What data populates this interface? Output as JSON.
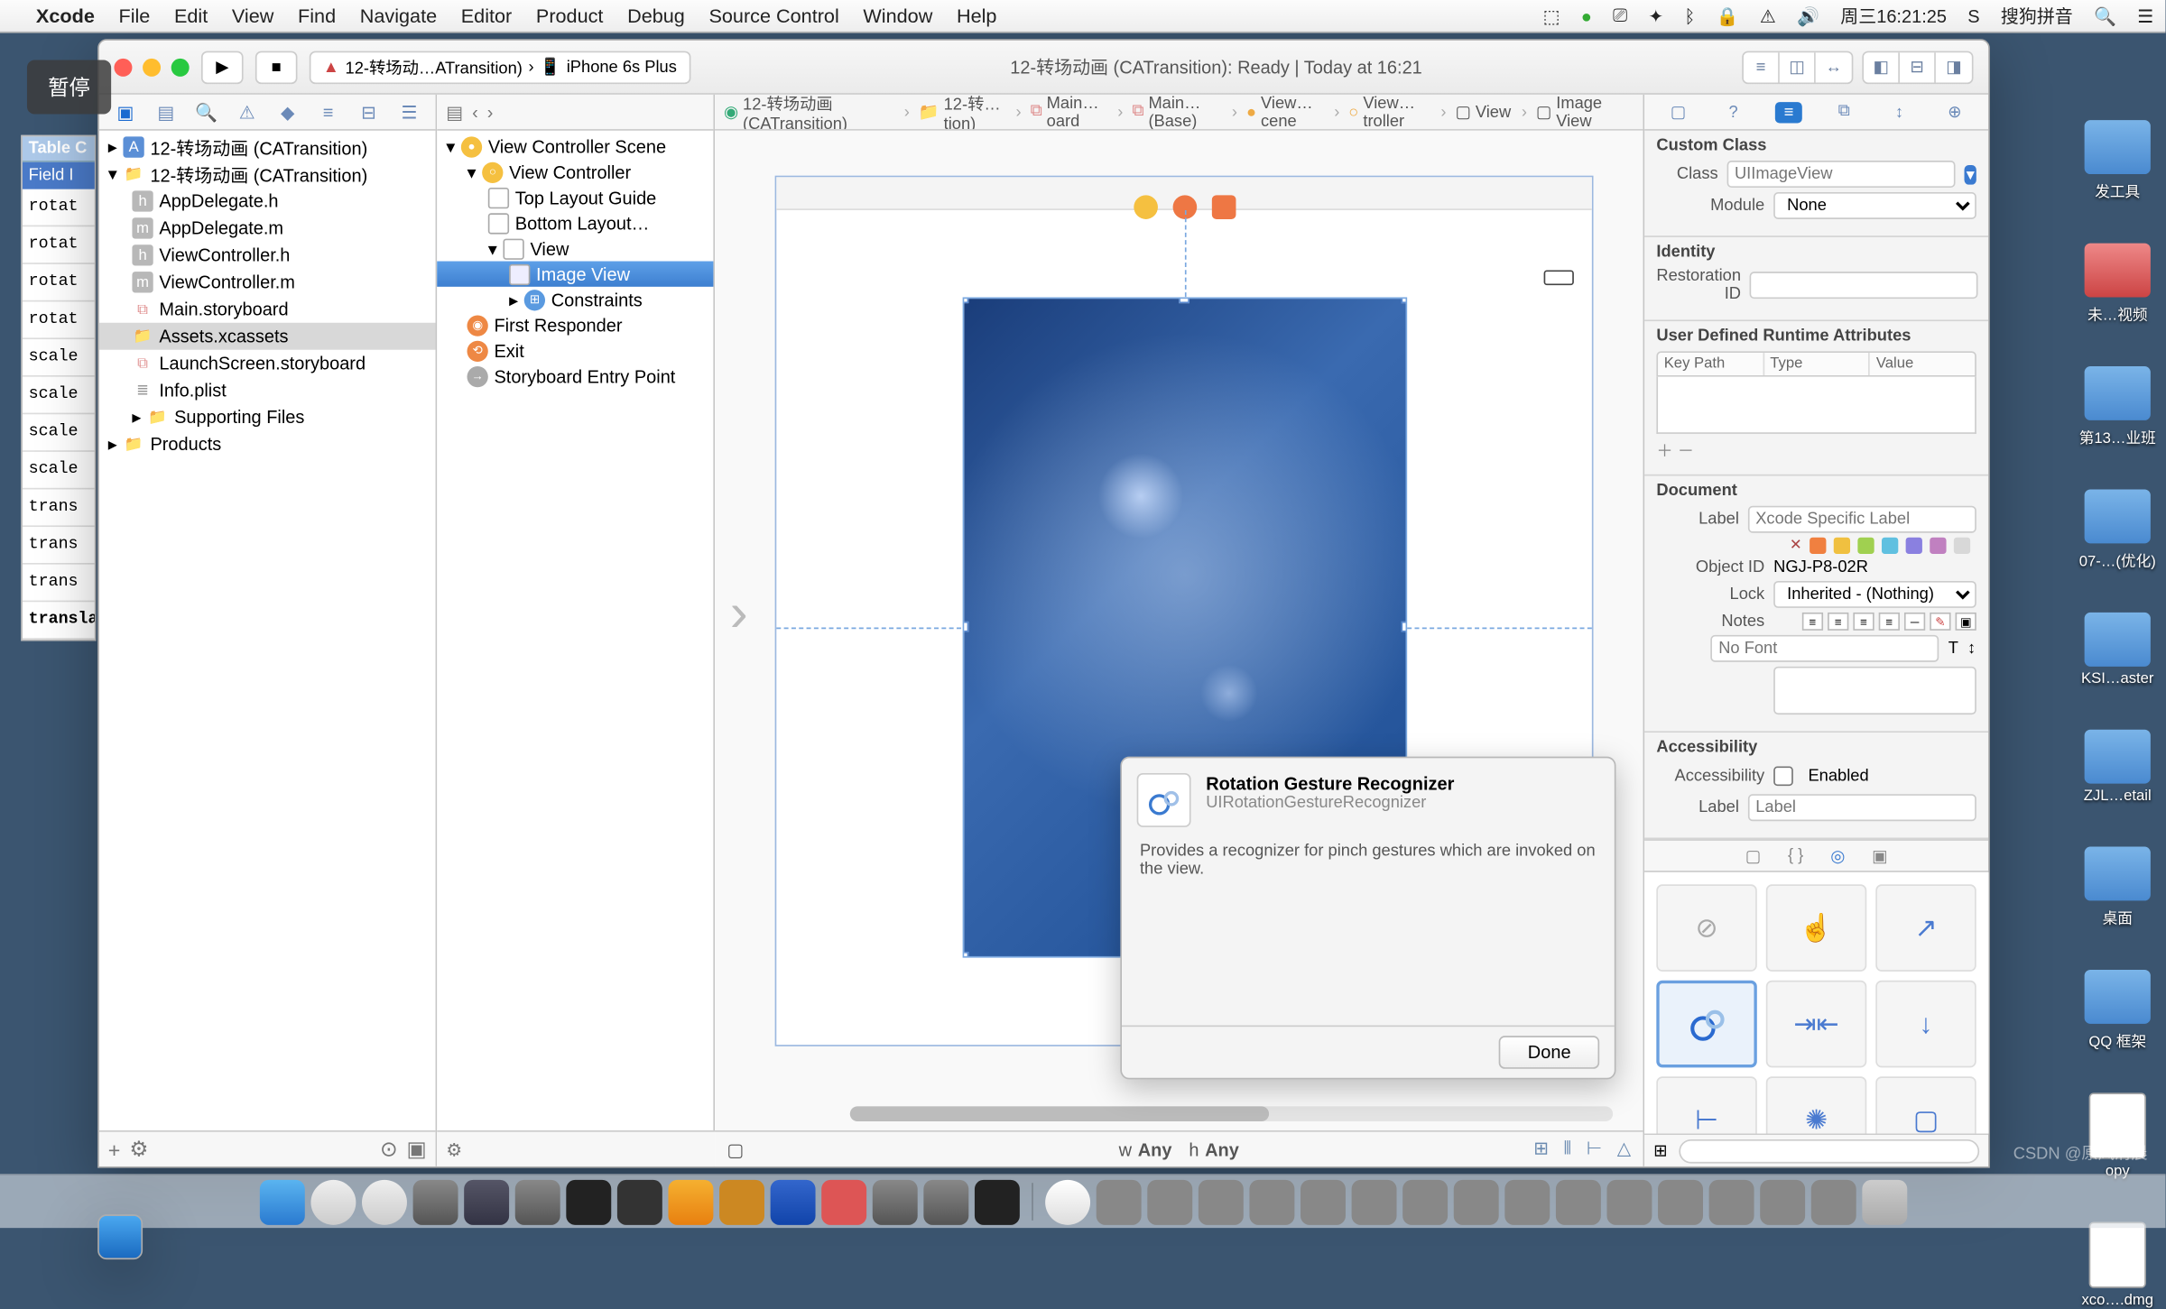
{
  "menubar": {
    "app": "Xcode",
    "items": [
      "File",
      "Edit",
      "View",
      "Find",
      "Navigate",
      "Editor",
      "Product",
      "Debug",
      "Source Control",
      "Window",
      "Help"
    ],
    "clock": "周三16:21:25",
    "ime": "搜狗拼音"
  },
  "overlay": {
    "pause": "暂停"
  },
  "bg_table": {
    "title": "Table C",
    "header": "Field I",
    "rows": [
      "rotat",
      "rotat",
      "rotat",
      "rotat",
      "scale",
      "scale",
      "scale",
      "scale",
      "trans",
      "trans",
      "trans",
      "transla"
    ]
  },
  "titlebar": {
    "scheme_proj": "12-转场动…ATransition)",
    "scheme_dev": "iPhone 6s Plus",
    "status": "12-转场动画 (CATransition): Ready  |  Today at 16:21"
  },
  "navigator": {
    "root": "12-转场动画 (CATransition)",
    "group": "12-转场动画 (CATransition)",
    "files": [
      "AppDelegate.h",
      "AppDelegate.m",
      "ViewController.h",
      "ViewController.m",
      "Main.storyboard",
      "Assets.xcassets",
      "LaunchScreen.storyboard",
      "Info.plist"
    ],
    "supporting": "Supporting Files",
    "products": "Products",
    "selected": "Assets.xcassets"
  },
  "outline": {
    "scene": "View Controller Scene",
    "vc": "View Controller",
    "top": "Top Layout Guide",
    "bottom": "Bottom Layout…",
    "view": "View",
    "imageview": "Image View",
    "constraints": "Constraints",
    "first": "First Responder",
    "exit": "Exit",
    "entry": "Storyboard Entry Point"
  },
  "jumpbar": {
    "items": [
      "12-转场动画 (CATransition)",
      "12-转…tion)",
      "Main…oard",
      "Main…(Base)",
      "View…cene",
      "View…troller",
      "View",
      "Image View"
    ]
  },
  "popover": {
    "title": "Rotation Gesture Recognizer",
    "subtitle": "UIRotationGestureRecognizer",
    "desc": "Provides a recognizer for pinch gestures which are invoked on the view.",
    "done": "Done"
  },
  "inspector": {
    "custom_class": "Custom Class",
    "class_label": "Class",
    "class_ph": "UIImageView",
    "module_label": "Module",
    "module_ph": "None",
    "identity": "Identity",
    "restoration": "Restoration ID",
    "udra": "User Defined Runtime Attributes",
    "cols": [
      "Key Path",
      "Type",
      "Value"
    ],
    "document": "Document",
    "label": "Label",
    "label_ph": "Xcode Specific Label",
    "objectid_l": "Object ID",
    "objectid": "NGJ-P8-02R",
    "lock_l": "Lock",
    "lock_v": "Inherited - (Nothing)",
    "notes_l": "Notes",
    "nofont": "No Font",
    "accessibility": "Accessibility",
    "acc_lab": "Accessibility",
    "enabled": "Enabled",
    "acc_label_l": "Label",
    "acc_label_ph": "Label",
    "swatches": [
      "#e8e8e8",
      "#f08040",
      "#f0c040",
      "#a0d050",
      "#60c0e0",
      "#8a80e0",
      "#c080c0",
      "#d8d8d8"
    ]
  },
  "sizebar": {
    "w": "w",
    "h": "h",
    "any": "Any"
  },
  "desktop": {
    "items": [
      "发工具",
      "未…视频",
      "第13…业班",
      "07-…(优化)",
      "KSI…aster",
      "ZJL…etail",
      "桌面",
      "QQ 框架",
      "opy",
      "xco….dmg"
    ]
  },
  "watermark": "CSDN @原风清晨"
}
